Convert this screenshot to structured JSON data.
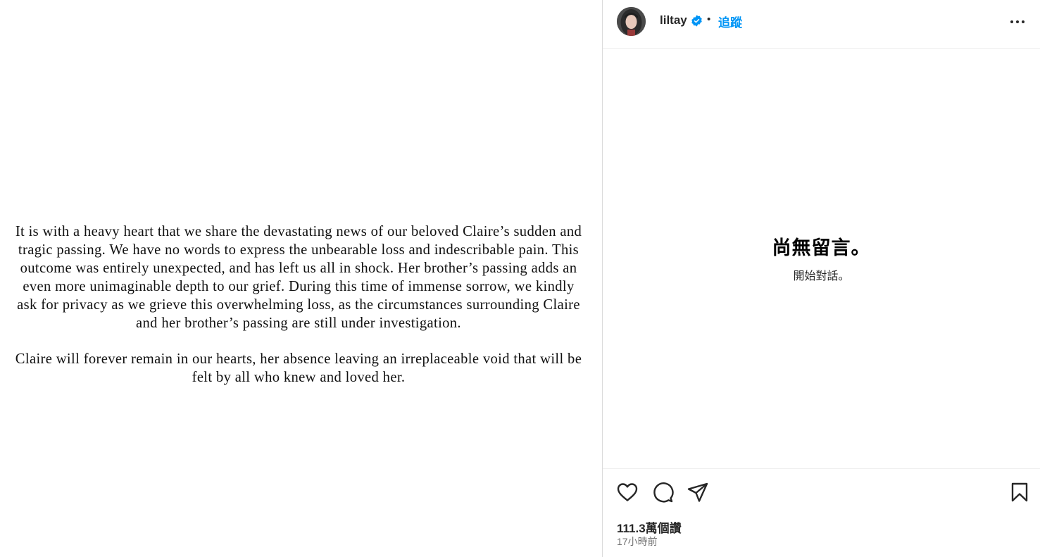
{
  "post": {
    "statement_paragraphs": [
      "It is with a heavy heart that we share the devastating news of our beloved Claire’s sudden and tragic passing. We have no words to express the unbearable loss and indescribable pain. This outcome was entirely unexpected, and has left us all in shock. Her brother’s passing adds an even more unimaginable depth to our grief. During this time of immense sorrow, we kindly ask for privacy as we grieve this overwhelming loss, as the circumstances surrounding Claire and her brother’s passing are still under investigation.",
      "Claire will forever remain in our hearts, her absence leaving an irreplaceable void that will be felt by all who knew and loved her."
    ]
  },
  "header": {
    "username": "liltay",
    "separator": "•",
    "follow_label": "追蹤",
    "verified_icon": "verified-badge-icon",
    "more_icon": "more-options-icon"
  },
  "comments": {
    "empty_title": "尚無留言。",
    "empty_subtitle": "開始對話。"
  },
  "actions": {
    "like_icon": "heart-icon",
    "comment_icon": "comment-icon",
    "share_icon": "share-icon",
    "save_icon": "bookmark-icon"
  },
  "stats": {
    "likes": "111.3萬個讚",
    "time_ago": "17小時前"
  },
  "colors": {
    "accent": "#0095f6",
    "verified": "#0095f6",
    "muted": "#737373",
    "border": "#dbdbdb"
  }
}
